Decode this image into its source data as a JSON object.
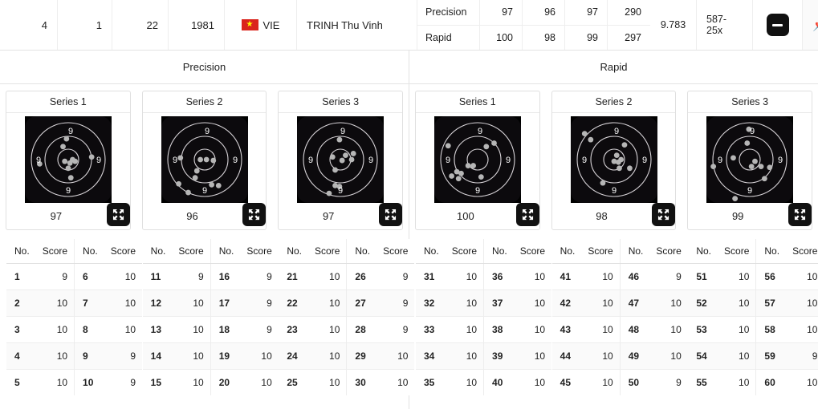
{
  "athlete": {
    "rank": "4",
    "lane": "1",
    "bib": "22",
    "birth_year": "1981",
    "nation_code": "VIE",
    "flag_star": "★",
    "name": "TRINH Thu Vinh",
    "decimal_average": "9.783",
    "grand_total": "587-25x",
    "collapse_label": "",
    "pin_label": "📌"
  },
  "stage_summary": [
    {
      "name": "Precision",
      "series": [
        "97",
        "96",
        "97"
      ],
      "total": "290"
    },
    {
      "name": "Rapid",
      "series": [
        "100",
        "98",
        "99"
      ],
      "total": "297"
    }
  ],
  "sections": [
    {
      "title": "Precision"
    },
    {
      "title": "Rapid"
    }
  ],
  "table_headers": {
    "no": "No.",
    "score": "Score"
  },
  "stages": [
    {
      "name": "Precision",
      "series": [
        {
          "title": "Series 1",
          "total": "97",
          "ring_labels": [
            "9",
            "9",
            "9",
            "9"
          ],
          "shots": [
            {
              "no": "1",
              "score": "9"
            },
            {
              "no": "2",
              "score": "10"
            },
            {
              "no": "3",
              "score": "10"
            },
            {
              "no": "4",
              "score": "10"
            },
            {
              "no": "5",
              "score": "10"
            },
            {
              "no": "6",
              "score": "10"
            },
            {
              "no": "7",
              "score": "10"
            },
            {
              "no": "8",
              "score": "10"
            },
            {
              "no": "9",
              "score": "9"
            },
            {
              "no": "10",
              "score": "9"
            }
          ],
          "shot_points": [
            [
              48,
              26
            ],
            [
              44,
              35
            ],
            [
              17,
              55
            ],
            [
              77,
              47
            ],
            [
              46,
              52
            ],
            [
              52,
              54
            ],
            [
              58,
              52
            ],
            [
              50,
              60
            ],
            [
              55,
              50
            ],
            [
              53,
              71
            ]
          ]
        },
        {
          "title": "Series 2",
          "total": "96",
          "ring_labels": [
            "9",
            "9",
            "9",
            "9"
          ],
          "shots": [
            {
              "no": "11",
              "score": "9"
            },
            {
              "no": "12",
              "score": "10"
            },
            {
              "no": "13",
              "score": "10"
            },
            {
              "no": "14",
              "score": "10"
            },
            {
              "no": "15",
              "score": "10"
            },
            {
              "no": "16",
              "score": "9"
            },
            {
              "no": "17",
              "score": "9"
            },
            {
              "no": "18",
              "score": "9"
            },
            {
              "no": "19",
              "score": "10"
            },
            {
              "no": "20",
              "score": "10"
            }
          ],
          "shot_points": [
            [
              22,
              48
            ],
            [
              45,
              50
            ],
            [
              52,
              50
            ],
            [
              60,
              51
            ],
            [
              41,
              63
            ],
            [
              39,
              71
            ],
            [
              58,
              79
            ],
            [
              20,
              78
            ],
            [
              31,
              88
            ],
            [
              66,
              80
            ]
          ]
        },
        {
          "title": "Series 3",
          "total": "97",
          "ring_labels": [
            "9",
            "9",
            "9",
            "9"
          ],
          "shots": [
            {
              "no": "21",
              "score": "10"
            },
            {
              "no": "22",
              "score": "10"
            },
            {
              "no": "23",
              "score": "10"
            },
            {
              "no": "24",
              "score": "10"
            },
            {
              "no": "25",
              "score": "10"
            },
            {
              "no": "26",
              "score": "9"
            },
            {
              "no": "27",
              "score": "9"
            },
            {
              "no": "28",
              "score": "9"
            },
            {
              "no": "29",
              "score": "10"
            },
            {
              "no": "30",
              "score": "10"
            }
          ],
          "shot_points": [
            [
              49,
              27
            ],
            [
              41,
              47
            ],
            [
              56,
              45
            ],
            [
              65,
              43
            ],
            [
              63,
              50
            ],
            [
              44,
              62
            ],
            [
              44,
              80
            ],
            [
              49,
              81
            ],
            [
              37,
              89
            ],
            [
              52,
              51
            ]
          ]
        }
      ]
    },
    {
      "name": "Rapid",
      "series": [
        {
          "title": "Series 1",
          "total": "100",
          "ring_labels": [
            "9",
            "9",
            "9",
            "9"
          ],
          "shots": [
            {
              "no": "31",
              "score": "10"
            },
            {
              "no": "32",
              "score": "10"
            },
            {
              "no": "33",
              "score": "10"
            },
            {
              "no": "34",
              "score": "10"
            },
            {
              "no": "35",
              "score": "10"
            },
            {
              "no": "36",
              "score": "10"
            },
            {
              "no": "37",
              "score": "10"
            },
            {
              "no": "38",
              "score": "10"
            },
            {
              "no": "39",
              "score": "10"
            },
            {
              "no": "40",
              "score": "10"
            }
          ],
          "shot_points": [
            [
              16,
              34
            ],
            [
              60,
              35
            ],
            [
              69,
              31
            ],
            [
              39,
              57
            ],
            [
              45,
              57
            ],
            [
              26,
              64
            ],
            [
              31,
              66
            ],
            [
              20,
              69
            ],
            [
              28,
              72
            ],
            [
              54,
              70
            ]
          ]
        },
        {
          "title": "Series 2",
          "total": "98",
          "ring_labels": [
            "9",
            "9",
            "9",
            "9"
          ],
          "shots": [
            {
              "no": "41",
              "score": "10"
            },
            {
              "no": "42",
              "score": "10"
            },
            {
              "no": "43",
              "score": "10"
            },
            {
              "no": "44",
              "score": "10"
            },
            {
              "no": "45",
              "score": "10"
            },
            {
              "no": "46",
              "score": "9"
            },
            {
              "no": "47",
              "score": "10"
            },
            {
              "no": "48",
              "score": "10"
            },
            {
              "no": "49",
              "score": "10"
            },
            {
              "no": "50",
              "score": "9"
            }
          ],
          "shot_points": [
            [
              16,
              20
            ],
            [
              23,
              27
            ],
            [
              62,
              33
            ],
            [
              53,
              45
            ],
            [
              58,
              50
            ],
            [
              55,
              53
            ],
            [
              56,
              60
            ],
            [
              68,
              60
            ],
            [
              37,
              77
            ],
            [
              50,
              52
            ]
          ]
        },
        {
          "title": "Series 3",
          "total": "99",
          "ring_labels": [
            "9",
            "9",
            "9",
            "9"
          ],
          "shots": [
            {
              "no": "51",
              "score": "10"
            },
            {
              "no": "52",
              "score": "10"
            },
            {
              "no": "53",
              "score": "10"
            },
            {
              "no": "54",
              "score": "10"
            },
            {
              "no": "55",
              "score": "10"
            },
            {
              "no": "56",
              "score": "10"
            },
            {
              "no": "57",
              "score": "10"
            },
            {
              "no": "58",
              "score": "10"
            },
            {
              "no": "59",
              "score": "9"
            },
            {
              "no": "60",
              "score": "10"
            }
          ],
          "shot_points": [
            [
              49,
              15
            ],
            [
              47,
              31
            ],
            [
              31,
              48
            ],
            [
              56,
              52
            ],
            [
              52,
              58
            ],
            [
              63,
              58
            ],
            [
              73,
              59
            ],
            [
              8,
              58
            ],
            [
              67,
              72
            ],
            [
              33,
              95
            ]
          ]
        }
      ]
    }
  ],
  "colors": {
    "target_bg": "#0c0a0d",
    "ring": "#d8d4d8",
    "shot": "#b6b6b6",
    "accent_black": "#111111",
    "flag_red": "#da251d",
    "flag_star": "#ffff00"
  }
}
